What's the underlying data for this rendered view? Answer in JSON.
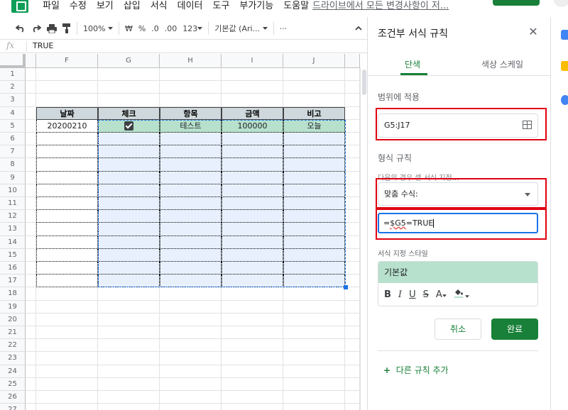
{
  "menu": {
    "items": [
      "파일",
      "수정",
      "보기",
      "삽입",
      "서식",
      "데이터",
      "도구",
      "부가기능",
      "도움말"
    ],
    "drive_link": "드라이브에서 모든 변경사항이 저..."
  },
  "toolbar": {
    "zoom": "100%",
    "currency": "₩",
    "percent": "%",
    "dec_decrease": ".0",
    "dec_increase": ".00",
    "more_formats": "123",
    "font": "기본값 (Ari...",
    "more": "···"
  },
  "formula_bar": {
    "fx": "fx",
    "value": "TRUE"
  },
  "grid": {
    "columns": [
      "F",
      "G",
      "H",
      "I",
      "J"
    ],
    "rows": [
      "1",
      "2",
      "3",
      "4",
      "5",
      "6",
      "7",
      "8",
      "9",
      "10",
      "11",
      "12",
      "13",
      "14",
      "15",
      "16",
      "17",
      "18",
      "19",
      "20",
      "21",
      "22",
      "23",
      "24",
      "25",
      "26",
      "27"
    ],
    "table_headers": [
      "날짜",
      "체크",
      "항목",
      "금액",
      "비고"
    ],
    "row5": {
      "date": "20200210",
      "checked": true,
      "item": "테스트",
      "amount": "100000",
      "note": "오늘"
    }
  },
  "panel": {
    "title": "조건부 서식 규칙",
    "close_icon": "close-icon",
    "tabs": [
      "단색",
      "색상 스케일"
    ],
    "range_label": "범위에 적용",
    "range_value": "G5:J17",
    "format_rules_label": "형식 규칙",
    "condition_label": "다음의 경우 셀 서식 지정...",
    "condition_value": "맞춤 수식:",
    "formula_prefix": "=",
    "formula_ref": "$G5",
    "formula_suffix": "=TRUE",
    "style_label": "서식 지정 스타일",
    "style_preview": "기본값",
    "style_tools": [
      "B",
      "I",
      "U",
      "S",
      "A"
    ],
    "cancel": "취소",
    "done": "완료",
    "add_rule": "다른 규칙 추가",
    "add_icon": "+"
  },
  "colors": {
    "accent": "#188038",
    "selection": "#1a73e8",
    "highlight_green": "#b7e1cd",
    "annotation_red": "#e00010"
  }
}
